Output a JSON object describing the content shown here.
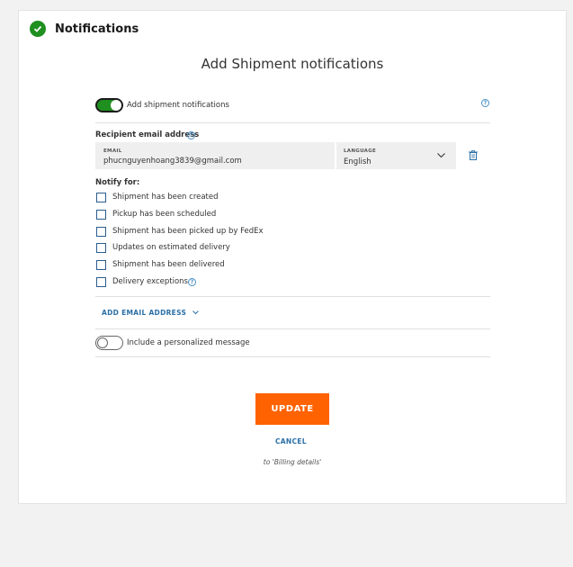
{
  "section": {
    "title": "Notifications"
  },
  "page": {
    "heading": "Add Shipment notifications"
  },
  "shipment_toggle": {
    "label": "Add shipment notifications",
    "enabled": true
  },
  "recipient": {
    "label": "Recipient email address",
    "email_label": "EMAIL",
    "email_value": "phucnguyenhoang3839@gmail.com",
    "language_label": "LANGUAGE",
    "language_value": "English"
  },
  "notify": {
    "label": "Notify for:",
    "options": [
      {
        "label": "Shipment has been created",
        "checked": false
      },
      {
        "label": "Pickup has been scheduled",
        "checked": false
      },
      {
        "label": "Shipment has been picked up by FedEx",
        "checked": false
      },
      {
        "label": "Updates on estimated delivery",
        "checked": false
      },
      {
        "label": "Shipment has been delivered",
        "checked": false
      },
      {
        "label": "Delivery exceptions",
        "checked": false
      }
    ]
  },
  "add_email": {
    "label": "ADD EMAIL ADDRESS"
  },
  "personal_message": {
    "label": "Include a personalized message",
    "enabled": false
  },
  "actions": {
    "update": "UPDATE",
    "cancel": "CANCEL",
    "next_step": "to 'Billing details'"
  },
  "colors": {
    "accent_green": "#1f8f1f",
    "update_orange": "#ff6200",
    "link_blue": "#2a6fa6"
  }
}
